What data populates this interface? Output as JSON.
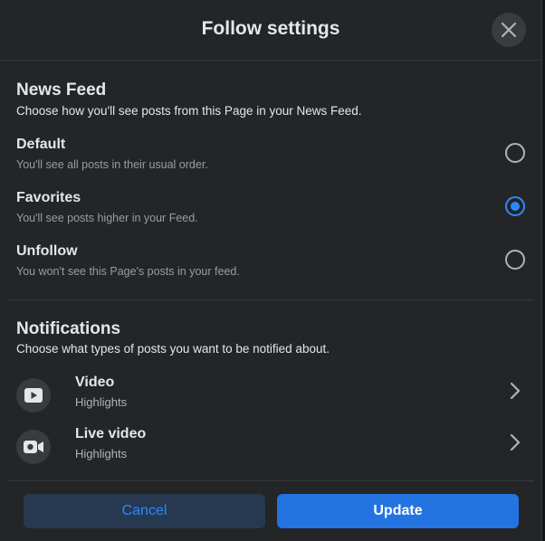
{
  "dialog": {
    "title": "Follow settings"
  },
  "news_feed": {
    "title": "News Feed",
    "subtitle": "Choose how you'll see posts from this Page in your News Feed.",
    "options": [
      {
        "label": "Default",
        "description": "You'll see all posts in their usual order.",
        "checked": false
      },
      {
        "label": "Favorites",
        "description": "You'll see posts higher in your Feed.",
        "checked": true
      },
      {
        "label": "Unfollow",
        "description": "You won't see this Page's posts in your feed.",
        "checked": false
      }
    ]
  },
  "notifications": {
    "title": "Notifications",
    "subtitle": "Choose what types of posts you want to be notified about.",
    "items": [
      {
        "label": "Video",
        "sub": "Highlights",
        "icon": "video-play-icon"
      },
      {
        "label": "Live video",
        "sub": "Highlights",
        "icon": "live-video-camera-icon"
      }
    ]
  },
  "footer": {
    "cancel_label": "Cancel",
    "update_label": "Update"
  },
  "colors": {
    "accent": "#2d88ff",
    "primary_button": "#2374e1",
    "surface": "#242526"
  }
}
